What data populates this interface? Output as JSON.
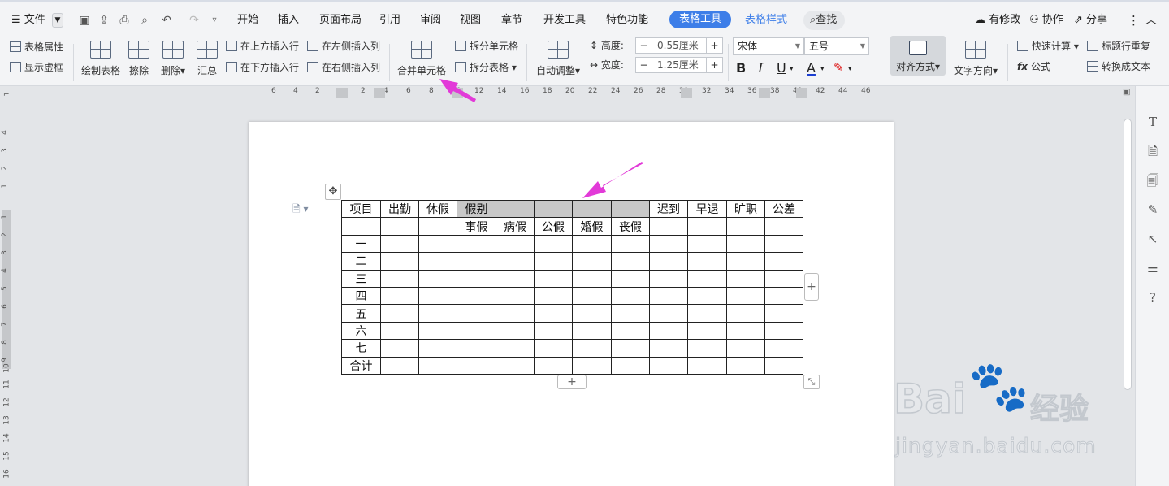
{
  "menu": {
    "file_label": "文件",
    "tabs": [
      {
        "label": "开始"
      },
      {
        "label": "插入"
      },
      {
        "label": "页面布局"
      },
      {
        "label": "引用"
      },
      {
        "label": "审阅"
      },
      {
        "label": "视图"
      },
      {
        "label": "章节"
      },
      {
        "label": "开发工具"
      },
      {
        "label": "特色功能"
      }
    ],
    "active_tab": "表格工具",
    "style_tab": "表格样式",
    "search": "查找",
    "modified": "有修改",
    "collab": "协作",
    "share": "分享"
  },
  "ribbon": {
    "table_props": "表格属性",
    "show_grid": "显示虚框",
    "draw_table": "绘制表格",
    "erase": "擦除",
    "delete": "删除",
    "summary": "汇总",
    "insert_above": "在上方插入行",
    "insert_below": "在下方插入行",
    "insert_left": "在左侧插入列",
    "insert_right": "在右侧插入列",
    "merge_cells": "合并单元格",
    "split_cells": "拆分单元格",
    "split_table": "拆分表格",
    "auto_fit": "自动调整",
    "height_label": "高度:",
    "height_value": "0.55厘米",
    "width_label": "宽度:",
    "width_value": "1.25厘米",
    "font": "宋体",
    "font_size": "五号",
    "bold": "B",
    "italic": "I",
    "underline": "U",
    "font_color": "A",
    "align": "对齐方式",
    "text_dir": "文字方向",
    "quick_calc": "快速计算",
    "title_repeat": "标题行重复",
    "formula": "公式",
    "to_text": "转换成文本"
  },
  "ruler_h": [
    "6",
    "4",
    "2",
    "2",
    "4",
    "6",
    "8",
    "10",
    "12",
    "14",
    "16",
    "18",
    "20",
    "22",
    "24",
    "26",
    "28",
    "30",
    "32",
    "34",
    "36",
    "38",
    "40",
    "42",
    "44",
    "46"
  ],
  "ruler_v": [
    "4",
    "3",
    "2",
    "1",
    "1",
    "2",
    "3",
    "4",
    "5",
    "6",
    "7",
    "8",
    "9",
    "10",
    "11",
    "12",
    "13",
    "14",
    "15",
    "16"
  ],
  "table": {
    "header1": [
      "项目",
      "出勤",
      "休假",
      "假别",
      "",
      "",
      "",
      "",
      "迟到",
      "早退",
      "旷职",
      "公差"
    ],
    "header2": [
      "",
      "",
      "",
      "事假",
      "病假",
      "公假",
      "婚假",
      "丧假",
      "",
      "",
      "",
      ""
    ],
    "row_labels": [
      "一",
      "二",
      "三",
      "四",
      "五",
      "六",
      "七",
      "合计"
    ]
  },
  "watermark": {
    "brand": "Bai",
    "brand_cn": "经验",
    "url": "jingyan.baidu.com"
  },
  "colors": {
    "accent": "#3d7ee8",
    "arrow": "#e23ad8",
    "selected_cell": "#c8c8c8"
  }
}
